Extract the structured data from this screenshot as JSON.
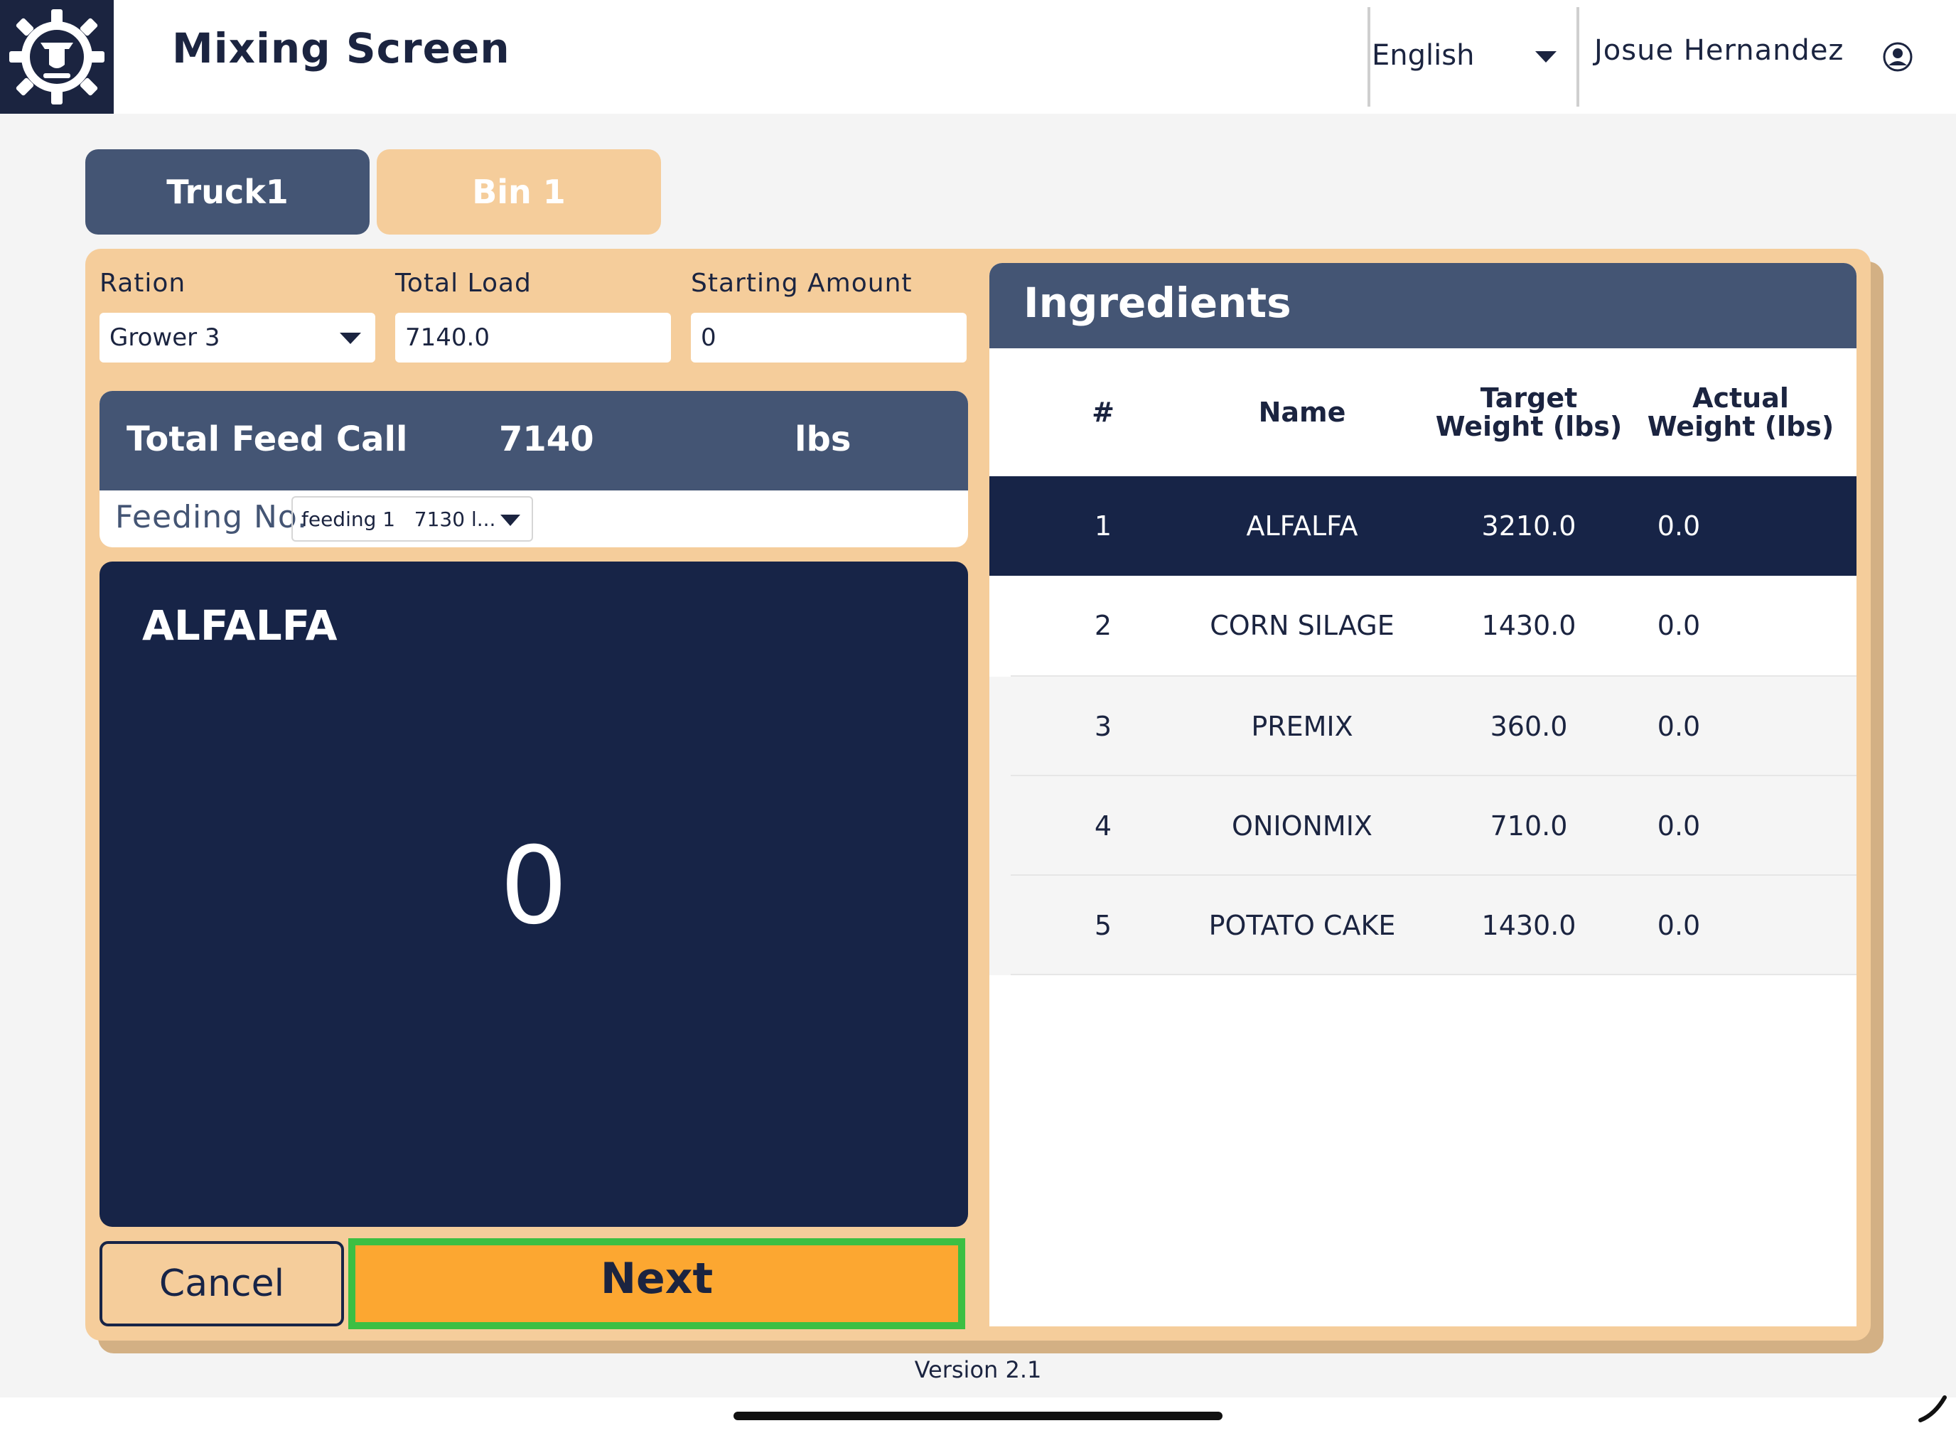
{
  "header": {
    "title": "Mixing Screen",
    "language": "English",
    "user_name": "Josue Hernandez"
  },
  "tabs": [
    {
      "label": "Truck1",
      "active": true
    },
    {
      "label": "Bin 1",
      "active": false
    }
  ],
  "form": {
    "ration_label": "Ration",
    "ration_value": "Grower 3",
    "total_load_label": "Total Load",
    "total_load_value": "7140.0",
    "starting_amount_label": "Starting Amount",
    "starting_amount_value": "0"
  },
  "feed_call": {
    "label": "Total Feed Call",
    "value": "7140",
    "unit": "lbs",
    "feeding_label": "Feeding No.",
    "feeding_value": "feeding 1   7130 l..."
  },
  "display": {
    "ingredient": "ALFALFA",
    "value": "0"
  },
  "buttons": {
    "cancel": "Cancel",
    "next": "Next"
  },
  "ingredients": {
    "title": "Ingredients",
    "columns": {
      "num": "#",
      "name": "Name",
      "target": "Target Weight (lbs)",
      "actual": "Actual Weight (lbs)"
    },
    "rows": [
      {
        "num": "1",
        "name": "ALFALFA",
        "target": "3210.0",
        "actual": "0.0"
      },
      {
        "num": "2",
        "name": "CORN SILAGE",
        "target": "1430.0",
        "actual": "0.0"
      },
      {
        "num": "3",
        "name": "PREMIX",
        "target": "360.0",
        "actual": "0.0"
      },
      {
        "num": "4",
        "name": "ONIONMIX",
        "target": "710.0",
        "actual": "0.0"
      },
      {
        "num": "5",
        "name": "POTATO CAKE",
        "target": "1430.0",
        "actual": "0.0"
      }
    ]
  },
  "footer": {
    "version": "Version 2.1"
  },
  "colors": {
    "navy": "#172447",
    "slate": "#445574",
    "tan": "#f5cd9b",
    "orange": "#fca731",
    "green": "#3cbf43"
  },
  "icons": {
    "logo": "gear-cow-logo-icon",
    "language_caret": "chevron-down-icon",
    "user": "user-circle-icon"
  }
}
